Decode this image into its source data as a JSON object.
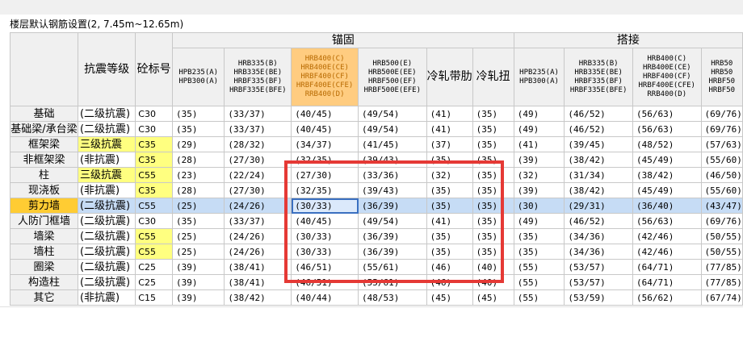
{
  "panel": {
    "title": "楼层默认钢筋设置(2, 7.45m~12.65m)"
  },
  "headers": {
    "anchor_group": "锚固",
    "lap_group": "搭接",
    "seismic_grade": "抗震等级",
    "concrete_grade": "砼标号",
    "anchor_steel": [
      "HPB235(A) HPB300(A)",
      "HRB335(B) HRB335E(BE) HRBF335(BF) HRBF335E(BFE)",
      "HRB400(C) HRB400E(CE) HRBF400(CF) HRBF400E(CFE) RRB400(D)",
      "HRB500(E) HRB500E(EE) HRBF500(EF) HRBF500E(EFE)",
      "冷轧带肋",
      "冷轧扭"
    ],
    "lap_steel": [
      "HPB235(A) HPB300(A)",
      "HRB335(B) HRB335E(BE) HRBF335(BF) HRBF335E(BFE)",
      "HRB400(C) HRB400E(CE) HRBF400(CF) HRBF400E(CFE) RRB400(D)",
      "HRB50 HRB50 HRBF50 HRBF50"
    ]
  },
  "rows": [
    {
      "name": "基础",
      "seismic": "(二级抗震)",
      "concrete": "C30",
      "anchor": [
        "(35)",
        "(33/37)",
        "(40/45)",
        "(49/54)",
        "(41)",
        "(35)"
      ],
      "lap": [
        "(49)",
        "(46/52)",
        "(56/63)",
        "(69/76)"
      ]
    },
    {
      "name": "基础梁/承台梁",
      "seismic": "(二级抗震)",
      "concrete": "C30",
      "anchor": [
        "(35)",
        "(33/37)",
        "(40/45)",
        "(49/54)",
        "(41)",
        "(35)"
      ],
      "lap": [
        "(49)",
        "(46/52)",
        "(56/63)",
        "(69/76)"
      ]
    },
    {
      "name": "框架梁",
      "seismic": "三级抗震",
      "concrete": "C35",
      "anchor": [
        "(29)",
        "(28/32)",
        "(34/37)",
        "(41/45)",
        "(37)",
        "(35)"
      ],
      "lap": [
        "(41)",
        "(39/45)",
        "(48/52)",
        "(57/63)"
      ]
    },
    {
      "name": "非框架梁",
      "seismic": "(非抗震)",
      "concrete": "C35",
      "anchor": [
        "(28)",
        "(27/30)",
        "(32/35)",
        "(39/43)",
        "(35)",
        "(35)"
      ],
      "lap": [
        "(39)",
        "(38/42)",
        "(45/49)",
        "(55/60)"
      ]
    },
    {
      "name": "柱",
      "seismic": "三级抗震",
      "concrete": "C55",
      "anchor": [
        "(23)",
        "(22/24)",
        "(27/30)",
        "(33/36)",
        "(32)",
        "(35)"
      ],
      "lap": [
        "(32)",
        "(31/34)",
        "(38/42)",
        "(46/50)"
      ]
    },
    {
      "name": "现浇板",
      "seismic": "(非抗震)",
      "concrete": "C35",
      "anchor": [
        "(28)",
        "(27/30)",
        "(32/35)",
        "(39/43)",
        "(35)",
        "(35)"
      ],
      "lap": [
        "(39)",
        "(38/42)",
        "(45/49)",
        "(55/60)"
      ]
    },
    {
      "name": "剪力墙",
      "seismic": "(二级抗震)",
      "concrete": "C55",
      "anchor": [
        "(25)",
        "(24/26)",
        "(30/33)",
        "(36/39)",
        "(35)",
        "(35)"
      ],
      "lap": [
        "(30)",
        "(29/31)",
        "(36/40)",
        "(43/47)"
      ]
    },
    {
      "name": "人防门框墙",
      "seismic": "(二级抗震)",
      "concrete": "C30",
      "anchor": [
        "(35)",
        "(33/37)",
        "(40/45)",
        "(49/54)",
        "(41)",
        "(35)"
      ],
      "lap": [
        "(49)",
        "(46/52)",
        "(56/63)",
        "(69/76)"
      ]
    },
    {
      "name": "墙梁",
      "seismic": "(二级抗震)",
      "concrete": "C55",
      "anchor": [
        "(25)",
        "(24/26)",
        "(30/33)",
        "(36/39)",
        "(35)",
        "(35)"
      ],
      "lap": [
        "(35)",
        "(34/36)",
        "(42/46)",
        "(50/55)"
      ]
    },
    {
      "name": "墙柱",
      "seismic": "(二级抗震)",
      "concrete": "C55",
      "anchor": [
        "(25)",
        "(24/26)",
        "(30/33)",
        "(36/39)",
        "(35)",
        "(35)"
      ],
      "lap": [
        "(35)",
        "(34/36)",
        "(42/46)",
        "(50/55)"
      ]
    },
    {
      "name": "圈梁",
      "seismic": "(二级抗震)",
      "concrete": "C25",
      "anchor": [
        "(39)",
        "(38/41)",
        "(46/51)",
        "(55/61)",
        "(46)",
        "(40)"
      ],
      "lap": [
        "(55)",
        "(53/57)",
        "(64/71)",
        "(77/85)"
      ]
    },
    {
      "name": "构造柱",
      "seismic": "(二级抗震)",
      "concrete": "C25",
      "anchor": [
        "(39)",
        "(38/41)",
        "(46/51)",
        "(55/61)",
        "(46)",
        "(40)"
      ],
      "lap": [
        "(55)",
        "(53/57)",
        "(64/71)",
        "(77/85)"
      ]
    },
    {
      "name": "其它",
      "seismic": "(非抗震)",
      "concrete": "C15",
      "anchor": [
        "(39)",
        "(38/42)",
        "(40/44)",
        "(48/53)",
        "(45)",
        "(45)"
      ],
      "lap": [
        "(55)",
        "(53/59)",
        "(56/62)",
        "(67/74)"
      ]
    }
  ],
  "colors": {
    "selected_row_name": "#ffcc33",
    "highlight_row": "#c6dcf5",
    "selected_column_header": "#ffcc80",
    "yellow_cell": "#ffff80",
    "red_annotation": "#e53935"
  }
}
